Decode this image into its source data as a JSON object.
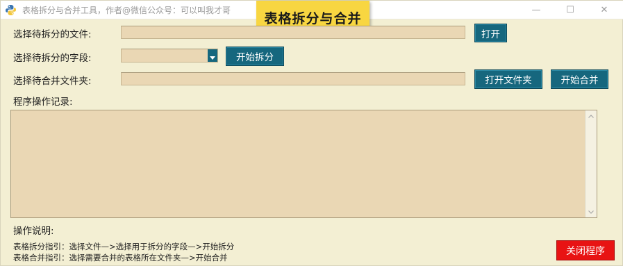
{
  "window": {
    "title": "表格拆分与合并工具，作者@微信公众号：可以叫我才哥",
    "minimize_symbol": "—",
    "maximize_symbol": "☐",
    "close_symbol": "✕"
  },
  "banner": {
    "text": "表格拆分与合并"
  },
  "form": {
    "file_label": "选择待拆分的文件:",
    "file_value": "",
    "open_button": "打开",
    "field_label": "选择待拆分的字段:",
    "field_selected": "",
    "split_button": "开始拆分",
    "folder_label": "选择待合并文件夹:",
    "folder_value": "",
    "open_folder_button": "打开文件夹",
    "merge_button": "开始合并"
  },
  "log": {
    "label": "程序操作记录:",
    "content": ""
  },
  "instructions": {
    "label": "操作说明:",
    "split_guide": "表格拆分指引：选择文件—>选择用于拆分的字段—>开始拆分",
    "merge_guide": "表格合并指引：选择需要合并的表格所在文件夹—>开始合并"
  },
  "close_program_button": "关闭程序",
  "icons": {
    "app": "python-icon",
    "combo": "chevron-down-icon",
    "scroll_up": "scroll-up-icon",
    "scroll_down": "scroll-down-icon"
  },
  "colors": {
    "window_bg": "#f3efd3",
    "field_bg": "#ead7b4",
    "button_bg": "#16677e",
    "banner_bg": "#f8d641",
    "close_button_bg": "#e81313"
  }
}
